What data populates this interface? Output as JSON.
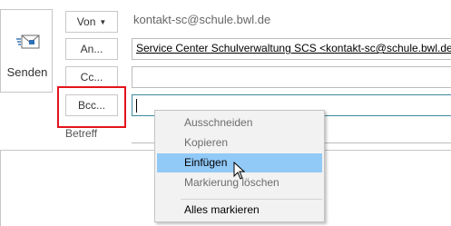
{
  "send": {
    "label": "Senden",
    "icon": "send-envelope-icon"
  },
  "from": {
    "button_label": "Von",
    "value": "kontakt-sc@schule.bwl.de"
  },
  "to": {
    "button_label": "An...",
    "recipient": "Service Center Schulverwaltung SCS <kontakt-sc@schule.bwl.de>;"
  },
  "cc": {
    "button_label": "Cc..."
  },
  "bcc": {
    "button_label": "Bcc..."
  },
  "subject": {
    "label": "Betreff"
  },
  "context_menu": {
    "cut": "Ausschneiden",
    "copy": "Kopieren",
    "paste": "Einfügen",
    "clear": "Markierung löschen",
    "select_all": "Alles markieren"
  },
  "colors": {
    "highlight_border": "#e2141c",
    "menu_hover": "#91c9f7",
    "active_field_border": "#3a8a9c"
  }
}
